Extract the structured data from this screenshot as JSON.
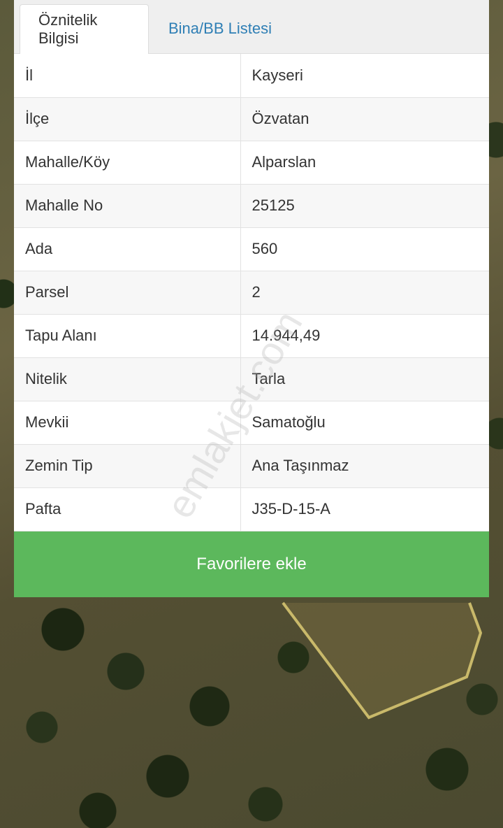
{
  "tabs": [
    {
      "label": "Öznitelik Bilgisi",
      "active": true
    },
    {
      "label": "Bina/BB Listesi",
      "active": false
    }
  ],
  "attributes": [
    {
      "key": "İl",
      "value": "Kayseri"
    },
    {
      "key": "İlçe",
      "value": "Özvatan"
    },
    {
      "key": "Mahalle/Köy",
      "value": "Alparslan"
    },
    {
      "key": "Mahalle No",
      "value": "25125"
    },
    {
      "key": "Ada",
      "value": "560"
    },
    {
      "key": "Parsel",
      "value": "2"
    },
    {
      "key": "Tapu Alanı",
      "value": "14.944,49"
    },
    {
      "key": "Nitelik",
      "value": "Tarla"
    },
    {
      "key": "Mevkii",
      "value": "Samatoğlu"
    },
    {
      "key": "Zemin Tip",
      "value": "Ana Taşınmaz"
    },
    {
      "key": "Pafta",
      "value": "J35-D-15-A"
    }
  ],
  "favorite_button": "Favorilere ekle",
  "watermark": "emlakjet.com",
  "colors": {
    "accent_green": "#5cb85c",
    "tab_link_blue": "#2f7fb5",
    "parcel_outline": "#c9b96a"
  }
}
